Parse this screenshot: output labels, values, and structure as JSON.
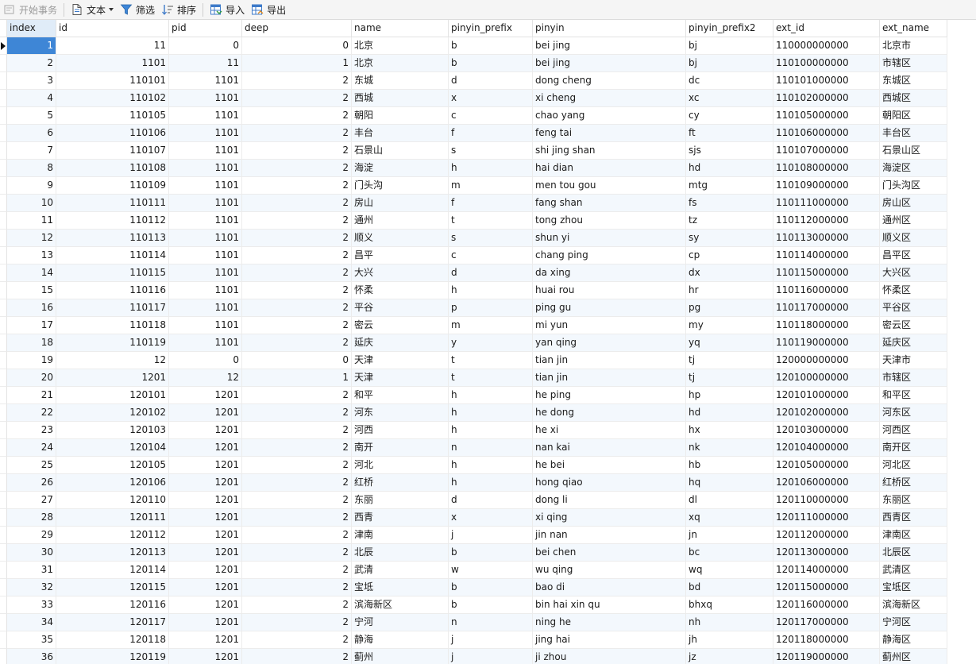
{
  "toolbar": {
    "begin_transaction": "开始事务",
    "text": "文本",
    "filter": "筛选",
    "sort": "排序",
    "import": "导入",
    "export": "导出"
  },
  "columns": [
    "index",
    "id",
    "pid",
    "deep",
    "name",
    "pinyin_prefix",
    "pinyin",
    "pinyin_prefix2",
    "ext_id",
    "ext_name"
  ],
  "selected_index": 1,
  "rows": [
    {
      "index": "1",
      "id": "11",
      "pid": "0",
      "deep": "0",
      "name": "北京",
      "pinyin_prefix": "b",
      "pinyin": "bei jing",
      "pinyin_prefix2": "bj",
      "ext_id": "110000000000",
      "ext_name": "北京市"
    },
    {
      "index": "2",
      "id": "1101",
      "pid": "11",
      "deep": "1",
      "name": "北京",
      "pinyin_prefix": "b",
      "pinyin": "bei jing",
      "pinyin_prefix2": "bj",
      "ext_id": "110100000000",
      "ext_name": "市辖区"
    },
    {
      "index": "3",
      "id": "110101",
      "pid": "1101",
      "deep": "2",
      "name": "东城",
      "pinyin_prefix": "d",
      "pinyin": "dong cheng",
      "pinyin_prefix2": "dc",
      "ext_id": "110101000000",
      "ext_name": "东城区"
    },
    {
      "index": "4",
      "id": "110102",
      "pid": "1101",
      "deep": "2",
      "name": "西城",
      "pinyin_prefix": "x",
      "pinyin": "xi cheng",
      "pinyin_prefix2": "xc",
      "ext_id": "110102000000",
      "ext_name": "西城区"
    },
    {
      "index": "5",
      "id": "110105",
      "pid": "1101",
      "deep": "2",
      "name": "朝阳",
      "pinyin_prefix": "c",
      "pinyin": "chao yang",
      "pinyin_prefix2": "cy",
      "ext_id": "110105000000",
      "ext_name": "朝阳区"
    },
    {
      "index": "6",
      "id": "110106",
      "pid": "1101",
      "deep": "2",
      "name": "丰台",
      "pinyin_prefix": "f",
      "pinyin": "feng tai",
      "pinyin_prefix2": "ft",
      "ext_id": "110106000000",
      "ext_name": "丰台区"
    },
    {
      "index": "7",
      "id": "110107",
      "pid": "1101",
      "deep": "2",
      "name": "石景山",
      "pinyin_prefix": "s",
      "pinyin": "shi jing shan",
      "pinyin_prefix2": "sjs",
      "ext_id": "110107000000",
      "ext_name": "石景山区"
    },
    {
      "index": "8",
      "id": "110108",
      "pid": "1101",
      "deep": "2",
      "name": "海淀",
      "pinyin_prefix": "h",
      "pinyin": "hai dian",
      "pinyin_prefix2": "hd",
      "ext_id": "110108000000",
      "ext_name": "海淀区"
    },
    {
      "index": "9",
      "id": "110109",
      "pid": "1101",
      "deep": "2",
      "name": "门头沟",
      "pinyin_prefix": "m",
      "pinyin": "men tou gou",
      "pinyin_prefix2": "mtg",
      "ext_id": "110109000000",
      "ext_name": "门头沟区"
    },
    {
      "index": "10",
      "id": "110111",
      "pid": "1101",
      "deep": "2",
      "name": "房山",
      "pinyin_prefix": "f",
      "pinyin": "fang shan",
      "pinyin_prefix2": "fs",
      "ext_id": "110111000000",
      "ext_name": "房山区"
    },
    {
      "index": "11",
      "id": "110112",
      "pid": "1101",
      "deep": "2",
      "name": "通州",
      "pinyin_prefix": "t",
      "pinyin": "tong zhou",
      "pinyin_prefix2": "tz",
      "ext_id": "110112000000",
      "ext_name": "通州区"
    },
    {
      "index": "12",
      "id": "110113",
      "pid": "1101",
      "deep": "2",
      "name": "顺义",
      "pinyin_prefix": "s",
      "pinyin": "shun yi",
      "pinyin_prefix2": "sy",
      "ext_id": "110113000000",
      "ext_name": "顺义区"
    },
    {
      "index": "13",
      "id": "110114",
      "pid": "1101",
      "deep": "2",
      "name": "昌平",
      "pinyin_prefix": "c",
      "pinyin": "chang ping",
      "pinyin_prefix2": "cp",
      "ext_id": "110114000000",
      "ext_name": "昌平区"
    },
    {
      "index": "14",
      "id": "110115",
      "pid": "1101",
      "deep": "2",
      "name": "大兴",
      "pinyin_prefix": "d",
      "pinyin": "da xing",
      "pinyin_prefix2": "dx",
      "ext_id": "110115000000",
      "ext_name": "大兴区"
    },
    {
      "index": "15",
      "id": "110116",
      "pid": "1101",
      "deep": "2",
      "name": "怀柔",
      "pinyin_prefix": "h",
      "pinyin": "huai rou",
      "pinyin_prefix2": "hr",
      "ext_id": "110116000000",
      "ext_name": "怀柔区"
    },
    {
      "index": "16",
      "id": "110117",
      "pid": "1101",
      "deep": "2",
      "name": "平谷",
      "pinyin_prefix": "p",
      "pinyin": "ping gu",
      "pinyin_prefix2": "pg",
      "ext_id": "110117000000",
      "ext_name": "平谷区"
    },
    {
      "index": "17",
      "id": "110118",
      "pid": "1101",
      "deep": "2",
      "name": "密云",
      "pinyin_prefix": "m",
      "pinyin": "mi yun",
      "pinyin_prefix2": "my",
      "ext_id": "110118000000",
      "ext_name": "密云区"
    },
    {
      "index": "18",
      "id": "110119",
      "pid": "1101",
      "deep": "2",
      "name": "延庆",
      "pinyin_prefix": "y",
      "pinyin": "yan qing",
      "pinyin_prefix2": "yq",
      "ext_id": "110119000000",
      "ext_name": "延庆区"
    },
    {
      "index": "19",
      "id": "12",
      "pid": "0",
      "deep": "0",
      "name": "天津",
      "pinyin_prefix": "t",
      "pinyin": "tian jin",
      "pinyin_prefix2": "tj",
      "ext_id": "120000000000",
      "ext_name": "天津市"
    },
    {
      "index": "20",
      "id": "1201",
      "pid": "12",
      "deep": "1",
      "name": "天津",
      "pinyin_prefix": "t",
      "pinyin": "tian jin",
      "pinyin_prefix2": "tj",
      "ext_id": "120100000000",
      "ext_name": "市辖区"
    },
    {
      "index": "21",
      "id": "120101",
      "pid": "1201",
      "deep": "2",
      "name": "和平",
      "pinyin_prefix": "h",
      "pinyin": "he ping",
      "pinyin_prefix2": "hp",
      "ext_id": "120101000000",
      "ext_name": "和平区"
    },
    {
      "index": "22",
      "id": "120102",
      "pid": "1201",
      "deep": "2",
      "name": "河东",
      "pinyin_prefix": "h",
      "pinyin": "he dong",
      "pinyin_prefix2": "hd",
      "ext_id": "120102000000",
      "ext_name": "河东区"
    },
    {
      "index": "23",
      "id": "120103",
      "pid": "1201",
      "deep": "2",
      "name": "河西",
      "pinyin_prefix": "h",
      "pinyin": "he xi",
      "pinyin_prefix2": "hx",
      "ext_id": "120103000000",
      "ext_name": "河西区"
    },
    {
      "index": "24",
      "id": "120104",
      "pid": "1201",
      "deep": "2",
      "name": "南开",
      "pinyin_prefix": "n",
      "pinyin": "nan kai",
      "pinyin_prefix2": "nk",
      "ext_id": "120104000000",
      "ext_name": "南开区"
    },
    {
      "index": "25",
      "id": "120105",
      "pid": "1201",
      "deep": "2",
      "name": "河北",
      "pinyin_prefix": "h",
      "pinyin": "he bei",
      "pinyin_prefix2": "hb",
      "ext_id": "120105000000",
      "ext_name": "河北区"
    },
    {
      "index": "26",
      "id": "120106",
      "pid": "1201",
      "deep": "2",
      "name": "红桥",
      "pinyin_prefix": "h",
      "pinyin": "hong qiao",
      "pinyin_prefix2": "hq",
      "ext_id": "120106000000",
      "ext_name": "红桥区"
    },
    {
      "index": "27",
      "id": "120110",
      "pid": "1201",
      "deep": "2",
      "name": "东丽",
      "pinyin_prefix": "d",
      "pinyin": "dong li",
      "pinyin_prefix2": "dl",
      "ext_id": "120110000000",
      "ext_name": "东丽区"
    },
    {
      "index": "28",
      "id": "120111",
      "pid": "1201",
      "deep": "2",
      "name": "西青",
      "pinyin_prefix": "x",
      "pinyin": "xi qing",
      "pinyin_prefix2": "xq",
      "ext_id": "120111000000",
      "ext_name": "西青区"
    },
    {
      "index": "29",
      "id": "120112",
      "pid": "1201",
      "deep": "2",
      "name": "津南",
      "pinyin_prefix": "j",
      "pinyin": "jin nan",
      "pinyin_prefix2": "jn",
      "ext_id": "120112000000",
      "ext_name": "津南区"
    },
    {
      "index": "30",
      "id": "120113",
      "pid": "1201",
      "deep": "2",
      "name": "北辰",
      "pinyin_prefix": "b",
      "pinyin": "bei chen",
      "pinyin_prefix2": "bc",
      "ext_id": "120113000000",
      "ext_name": "北辰区"
    },
    {
      "index": "31",
      "id": "120114",
      "pid": "1201",
      "deep": "2",
      "name": "武清",
      "pinyin_prefix": "w",
      "pinyin": "wu qing",
      "pinyin_prefix2": "wq",
      "ext_id": "120114000000",
      "ext_name": "武清区"
    },
    {
      "index": "32",
      "id": "120115",
      "pid": "1201",
      "deep": "2",
      "name": "宝坻",
      "pinyin_prefix": "b",
      "pinyin": "bao di",
      "pinyin_prefix2": "bd",
      "ext_id": "120115000000",
      "ext_name": "宝坻区"
    },
    {
      "index": "33",
      "id": "120116",
      "pid": "1201",
      "deep": "2",
      "name": "滨海新区",
      "pinyin_prefix": "b",
      "pinyin": "bin hai xin qu",
      "pinyin_prefix2": "bhxq",
      "ext_id": "120116000000",
      "ext_name": "滨海新区"
    },
    {
      "index": "34",
      "id": "120117",
      "pid": "1201",
      "deep": "2",
      "name": "宁河",
      "pinyin_prefix": "n",
      "pinyin": "ning he",
      "pinyin_prefix2": "nh",
      "ext_id": "120117000000",
      "ext_name": "宁河区"
    },
    {
      "index": "35",
      "id": "120118",
      "pid": "1201",
      "deep": "2",
      "name": "静海",
      "pinyin_prefix": "j",
      "pinyin": "jing hai",
      "pinyin_prefix2": "jh",
      "ext_id": "120118000000",
      "ext_name": "静海区"
    },
    {
      "index": "36",
      "id": "120119",
      "pid": "1201",
      "deep": "2",
      "name": "蓟州",
      "pinyin_prefix": "j",
      "pinyin": "ji zhou",
      "pinyin_prefix2": "jz",
      "ext_id": "120119000000",
      "ext_name": "蓟州区"
    }
  ]
}
